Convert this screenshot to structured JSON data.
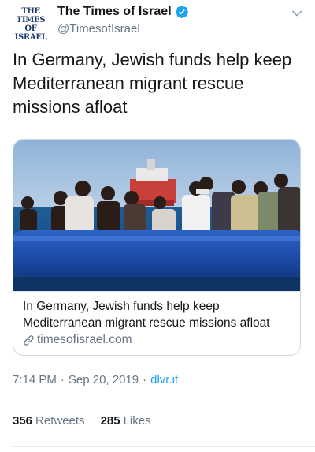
{
  "author": {
    "avatar_text": "THE TIMES\nOF ISRAEL",
    "display_name": "The Times of Israel",
    "handle": "@TimesofIsrael",
    "verified_icon": "verified-badge-icon"
  },
  "tweet": {
    "text": "In Germany, Jewish funds help keep Mediterranean migrant rescue missions afloat"
  },
  "card": {
    "image_icon": "photo-migrants-in-rubber-boat",
    "title": "In Germany, Jewish funds help keep Mediterranean migrant rescue missions afloat",
    "domain": "timesofisrael.com"
  },
  "meta": {
    "time": "7:14 PM",
    "date": "Sep 20, 2019",
    "separator": "·",
    "source": "dlvr.it"
  },
  "stats": {
    "retweets_count": "356",
    "retweets_label": "Retweets",
    "likes_count": "285",
    "likes_label": "Likes"
  },
  "colors": {
    "link_blue": "#1da1f2",
    "secondary_text": "#657786",
    "verified_blue": "#1da1f2"
  }
}
